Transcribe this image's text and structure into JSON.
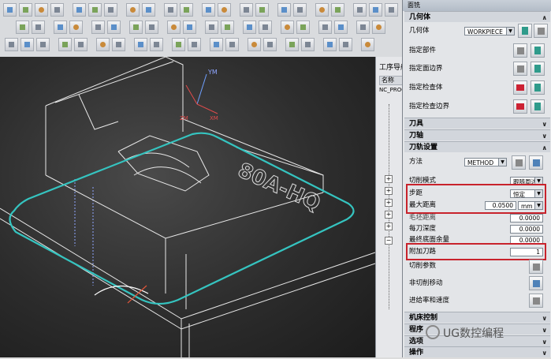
{
  "dialog": {
    "title": "面铣",
    "geometry": {
      "header": "几何体",
      "geometry_label": "几何体",
      "geometry_value": "WORKPIECE",
      "part_label": "指定部件",
      "face_boundary_label": "指定面边界",
      "check_body_label": "指定检查体",
      "check_boundary_label": "指定检查边界"
    },
    "tool_header": "刀具",
    "axis_header": "刀轴",
    "path_settings": {
      "header": "刀轨设置",
      "method_label": "方法",
      "method_value": "METHOD",
      "cut_mode_label": "切削模式",
      "cut_mode_value": "跟随周边",
      "stepover_label": "步距",
      "stepover_value": "恒定",
      "max_distance_label": "最大距离",
      "max_distance_value": "0.0500",
      "max_distance_unit": "mm",
      "blank_distance_label": "毛坯距离",
      "blank_distance_value": "0.0000",
      "depth_per_cut_label": "每刀深度",
      "depth_per_cut_value": "0.0000",
      "final_floor_stock_label": "最终底面余量",
      "final_floor_stock_value": "0.0000",
      "extra_passes_label": "附加刀路",
      "extra_passes_value": "1",
      "cut_params_label": "切削参数",
      "non_cutting_label": "非切削移动",
      "feeds_label": "进给率和速度"
    },
    "machine_control_header": "机床控制",
    "program_header": "程序",
    "options_header": "选项",
    "actions_header": "操作"
  },
  "navigator": {
    "title": "工序导航",
    "column_name": "名称",
    "program_root": "NC_PROG"
  },
  "viewport": {
    "part_text": "80A-HQ",
    "axis_ym": "YM",
    "axis_zm": "ZM",
    "axis_xm": "XM"
  },
  "watermark": "UG数控编程",
  "colors": {
    "highlight": "#c8232c",
    "toolpath": "#35c4c0"
  }
}
